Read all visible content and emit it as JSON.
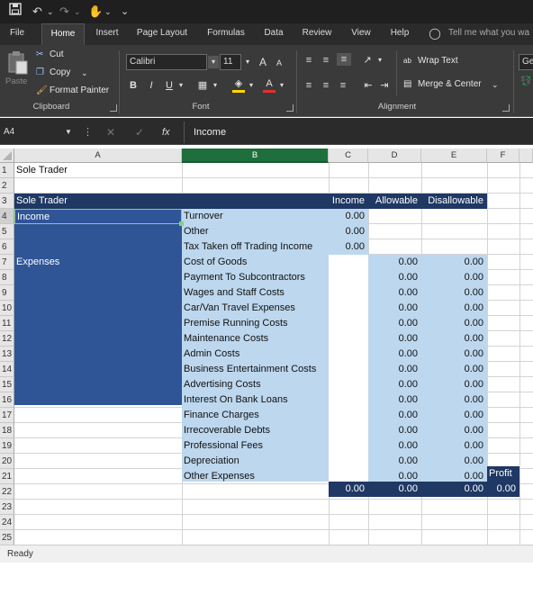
{
  "qat": {
    "undo_glyph": "↶",
    "redo_glyph": "↷",
    "touch_glyph": "✋",
    "customize_glyph": "⌄"
  },
  "tabs": [
    {
      "label": "File"
    },
    {
      "label": "Home"
    },
    {
      "label": "Insert"
    },
    {
      "label": "Page Layout"
    },
    {
      "label": "Formulas"
    },
    {
      "label": "Data"
    },
    {
      "label": "Review"
    },
    {
      "label": "View"
    },
    {
      "label": "Help"
    }
  ],
  "tell_me": "Tell me what you wa",
  "clipboard": {
    "paste": "Paste",
    "cut": "Cut",
    "copy": "Copy",
    "format_painter": "Format Painter",
    "group": "Clipboard"
  },
  "font": {
    "name": "Calibri",
    "size": "11",
    "bold": "B",
    "italic": "I",
    "underline": "U",
    "grow": "A",
    "shrink": "A",
    "font_color": "A",
    "group": "Font"
  },
  "alignment": {
    "wrap_text": "Wrap Text",
    "merge_center": "Merge & Center",
    "group": "Alignment",
    "wrap_glyph": "ab"
  },
  "number": {
    "format": "Ger"
  },
  "formula_bar": {
    "name_box": "A4",
    "cancel": "✕",
    "enter": "✓",
    "fx": "fx",
    "value": "Income"
  },
  "columns": [
    "A",
    "B",
    "C",
    "D",
    "E",
    "F"
  ],
  "rows": [
    "1",
    "2",
    "3",
    "4",
    "5",
    "6",
    "7",
    "8",
    "9",
    "10",
    "11",
    "12",
    "13",
    "14",
    "15",
    "16",
    "17",
    "18",
    "19",
    "20",
    "21",
    "22",
    "23",
    "24",
    "25"
  ],
  "sheet": {
    "a1": "Sole Trader",
    "header": {
      "a": "Sole Trader",
      "c": "Income",
      "d": "Allowable",
      "e": "Disallowable"
    },
    "a4": "Income",
    "a7": "Expenses",
    "income_items": [
      {
        "label": "Turnover",
        "c": "0.00"
      },
      {
        "label": "Other",
        "c": "0.00"
      },
      {
        "label": "Tax Taken off Trading Income",
        "c": "0.00"
      }
    ],
    "expense_items": [
      {
        "label": "Cost of Goods",
        "d": "0.00",
        "e": "0.00"
      },
      {
        "label": "Payment To Subcontractors",
        "d": "0.00",
        "e": "0.00"
      },
      {
        "label": "Wages and Staff Costs",
        "d": "0.00",
        "e": "0.00"
      },
      {
        "label": "Car/Van Travel Expenses",
        "d": "0.00",
        "e": "0.00"
      },
      {
        "label": "Premise Running Costs",
        "d": "0.00",
        "e": "0.00"
      },
      {
        "label": "Maintenance Costs",
        "d": "0.00",
        "e": "0.00"
      },
      {
        "label": "Admin Costs",
        "d": "0.00",
        "e": "0.00"
      },
      {
        "label": "Business Entertainment Costs",
        "d": "0.00",
        "e": "0.00"
      },
      {
        "label": "Advertising Costs",
        "d": "0.00",
        "e": "0.00"
      },
      {
        "label": "Interest On Bank Loans",
        "d": "0.00",
        "e": "0.00"
      },
      {
        "label": "Finance Charges",
        "d": "0.00",
        "e": "0.00"
      },
      {
        "label": "Irrecoverable Debts",
        "d": "0.00",
        "e": "0.00"
      },
      {
        "label": "Professional Fees",
        "d": "0.00",
        "e": "0.00"
      },
      {
        "label": "Depreciation",
        "d": "0.00",
        "e": "0.00"
      },
      {
        "label": "Other Expenses",
        "d": "0.00",
        "e": "0.00"
      }
    ],
    "profit_label": "Profit",
    "totals": {
      "c": "0.00",
      "d": "0.00",
      "e": "0.00",
      "f": "0.00"
    }
  },
  "status": "Ready",
  "colors": {
    "dark_blue": "#1f3864",
    "mid_blue": "#2f5597",
    "light_blue": "#bdd7ee",
    "excel_green": "#1e6f3c"
  }
}
